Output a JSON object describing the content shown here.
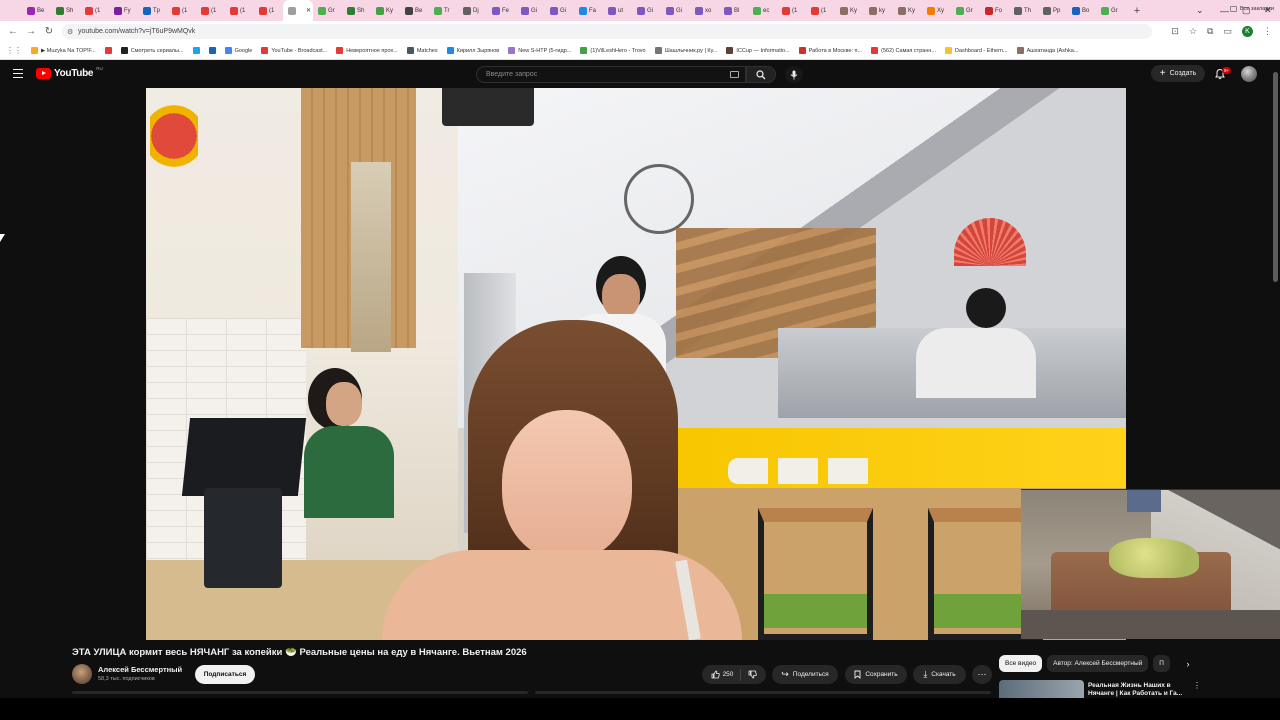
{
  "browser": {
    "tabs": [
      {
        "label": "Be",
        "color": "#9c27b0"
      },
      {
        "label": "Sh",
        "color": "#2e7d32"
      },
      {
        "label": "(1",
        "color": "#e53935"
      },
      {
        "label": "Fy",
        "color": "#7b1fa2"
      },
      {
        "label": "Tp",
        "color": "#1565c0"
      },
      {
        "label": "(1",
        "color": "#e53935"
      },
      {
        "label": "(1",
        "color": "#e53935"
      },
      {
        "label": "(1",
        "color": "#e53935"
      },
      {
        "label": "(1",
        "color": "#e53935"
      },
      {
        "label": "",
        "color": "#9e9e9e",
        "active": true
      },
      {
        "label": "Gr",
        "color": "#4caf50"
      },
      {
        "label": "Sh",
        "color": "#2e7d32"
      },
      {
        "label": "Ky",
        "color": "#43a047"
      },
      {
        "label": "Be",
        "color": "#424242"
      },
      {
        "label": "Tr",
        "color": "#4caf50"
      },
      {
        "label": "Dj",
        "color": "#616161"
      },
      {
        "label": "Fe",
        "color": "#7e57c2"
      },
      {
        "label": "Gi",
        "color": "#7e57c2"
      },
      {
        "label": "Gi",
        "color": "#7e57c2"
      },
      {
        "label": "Fa",
        "color": "#1e88e5"
      },
      {
        "label": "ut",
        "color": "#7e57c2"
      },
      {
        "label": "Gi",
        "color": "#7e57c2"
      },
      {
        "label": "Gi",
        "color": "#7e57c2"
      },
      {
        "label": "xo",
        "color": "#7e57c2"
      },
      {
        "label": "Bl",
        "color": "#7e57c2"
      },
      {
        "label": "ec",
        "color": "#4caf50"
      },
      {
        "label": "(1",
        "color": "#e53935"
      },
      {
        "label": "(1",
        "color": "#e53935"
      },
      {
        "label": "Ky",
        "color": "#8d6e63"
      },
      {
        "label": "ky",
        "color": "#8d6e63"
      },
      {
        "label": "Ky",
        "color": "#8d6e63"
      },
      {
        "label": "Xy",
        "color": "#f57c00"
      },
      {
        "label": "Gr",
        "color": "#4caf50"
      },
      {
        "label": "Fo",
        "color": "#c62828"
      },
      {
        "label": "Th",
        "color": "#616161"
      },
      {
        "label": "Pp",
        "color": "#616161"
      },
      {
        "label": "Bo",
        "color": "#1565c0"
      },
      {
        "label": "Gr",
        "color": "#4caf50"
      }
    ],
    "new_tab": "+",
    "url": "youtube.com/watch?v=jT6uP9wMQvk",
    "profile_letter": "K",
    "bookmarks": [
      {
        "label": "▶ Muzyka Na TOP!F...",
        "color": "#f9a825"
      },
      {
        "label": "",
        "color": "#e53935"
      },
      {
        "label": "Смотреть сериалы...",
        "color": "#212121"
      },
      {
        "label": "",
        "color": "#1da1f2"
      },
      {
        "label": "",
        "color": "#1565c0"
      },
      {
        "label": "Google",
        "color": "#4285f4"
      },
      {
        "label": "YouTube - Broadcast...",
        "color": "#e53935"
      },
      {
        "label": "Невероятное прох...",
        "color": "#e53935"
      },
      {
        "label": "Matches",
        "color": "#455a64"
      },
      {
        "label": "Кирилл Зырянов",
        "color": "#1e88e5"
      },
      {
        "label": "New S-HTP (5-гидр...",
        "color": "#9575cd"
      },
      {
        "label": "(1)VilLeshHero - Trovo",
        "color": "#43a047"
      },
      {
        "label": "Шашлычник.ру | Ку...",
        "color": "#757575"
      },
      {
        "label": "ICCup — Informatio...",
        "color": "#5d4037"
      },
      {
        "label": "Работа в Москве: п...",
        "color": "#d32f2f"
      },
      {
        "label": "(562) Самая странн...",
        "color": "#e53935"
      },
      {
        "label": "Dashboard - Ethern...",
        "color": "#fbc02d"
      },
      {
        "label": "Ашхатанда (Ashka...",
        "color": "#8d6e63"
      }
    ],
    "all_bookmarks": "Все закладки"
  },
  "youtube": {
    "logo_text": "YouTube",
    "region": "RU",
    "search_placeholder": "Введите запрос",
    "create_label": "Создать",
    "notif_badge": "9+"
  },
  "video": {
    "title": "ЭТА УЛИЦА кормит весь НЯЧАНГ за копейки 🥗 Реальные цены на еду в Нячанге. Вьетнам 2026",
    "channel_name": "Алексей Бессмертный",
    "subscribers": "58,3 тыс. подписчиков",
    "subscribe_label": "Подписаться",
    "likes": "250",
    "share_label": "Поделиться",
    "save_label": "Сохранить",
    "download_label": "Скачать"
  },
  "sidebar": {
    "chips": [
      "Все видео",
      "Автор: Алексей Бессмертный",
      "П"
    ],
    "recommendation_title": "Реальная Жизнь Наших в Нячанге | Как Работать и Га..."
  },
  "colors": {
    "brand_red": "#ff0000",
    "background": "#0f0f0f",
    "chip_bg": "#272727"
  }
}
